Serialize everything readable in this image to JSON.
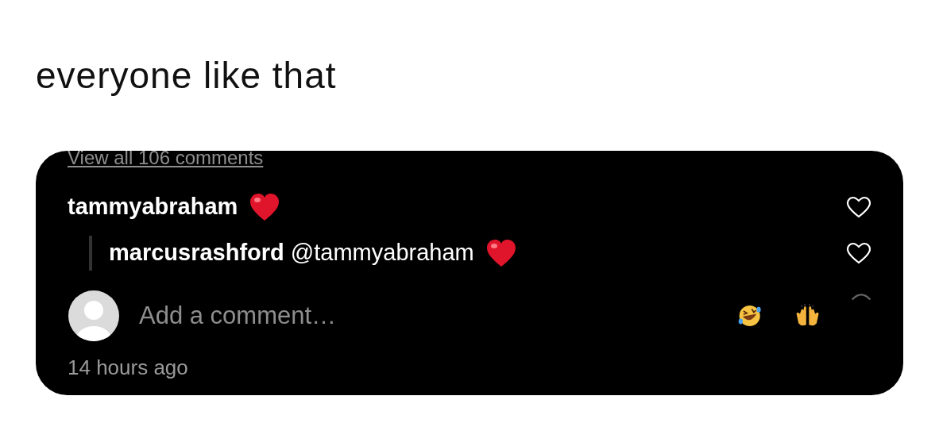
{
  "caption": "everyone like that",
  "comments_link": "View all 106 comments",
  "comments": [
    {
      "username": "tammyabraham",
      "liked": false,
      "replies": [
        {
          "username": "marcusrashford",
          "mention": "@tammyabraham",
          "liked": false
        }
      ]
    }
  ],
  "composer": {
    "placeholder": "Add a comment…"
  },
  "timestamp": "14 hours ago"
}
